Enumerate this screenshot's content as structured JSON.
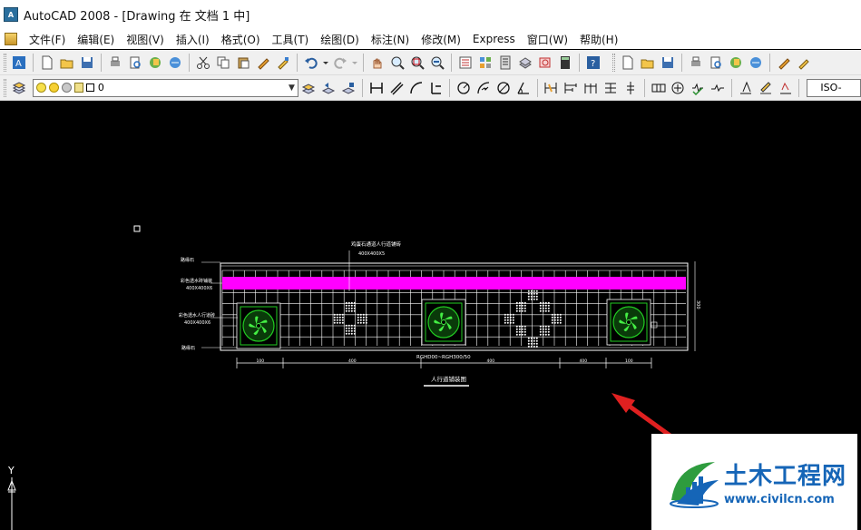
{
  "window": {
    "app_icon_text": "A",
    "title": "AutoCAD 2008 - [Drawing 在 文档 1 中]"
  },
  "menubar": {
    "items": [
      "文件(F)",
      "编辑(E)",
      "视图(V)",
      "插入(I)",
      "格式(O)",
      "工具(T)",
      "绘图(D)",
      "标注(N)",
      "修改(M)",
      "Express",
      "窗口(W)",
      "帮助(H)"
    ]
  },
  "toolbar2": {
    "layer_value": "0",
    "dimstyle_value": "ISO-"
  },
  "drawing": {
    "background": "#000000",
    "grid_color": "#ffffff",
    "band_color": "#ff00ff",
    "emblem_color": "#22cc22",
    "dimension_text": "RGHD00~RGH300/50",
    "plan_title": "人行道铺装图",
    "annotation_top": "鸡蛋石通道人行道铺砖",
    "annotation_top_sub": "400X400X5",
    "label_1": "路缘石",
    "label_2": "彩色透水砖铺装",
    "label_2_sub": "400X400X6",
    "label_3": "彩色透水人行道砖",
    "label_3_sub": "400X400X6",
    "label_4": "路缘石",
    "dim_segments": [
      "100",
      "400",
      "400",
      "400",
      "100"
    ],
    "right_dim": "300",
    "ucs_label": "Y"
  },
  "watermark": {
    "name": "土木工程网",
    "url": "www.civilcn.com"
  },
  "colors": {
    "arrow": "#e02020",
    "brand": "#1565b7"
  }
}
